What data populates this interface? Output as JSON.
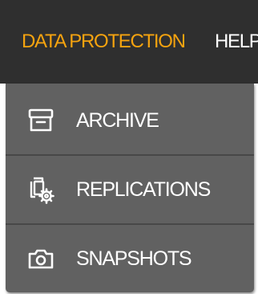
{
  "topnav": {
    "items": [
      {
        "label": "DATA PROTECTION",
        "active": true
      },
      {
        "label": "HELP",
        "active": false
      }
    ]
  },
  "dropdown": {
    "items": [
      {
        "label": "ARCHIVE",
        "icon": "archive-box-icon"
      },
      {
        "label": "REPLICATIONS",
        "icon": "replication-gear-icon"
      },
      {
        "label": "SNAPSHOTS",
        "icon": "camera-icon"
      }
    ]
  },
  "colors": {
    "topbar_background": "#2f2f2f",
    "active_nav_text": "#f5a30f",
    "nav_text": "#ffffff",
    "dropdown_background": "#616161",
    "divider": "#484848"
  }
}
